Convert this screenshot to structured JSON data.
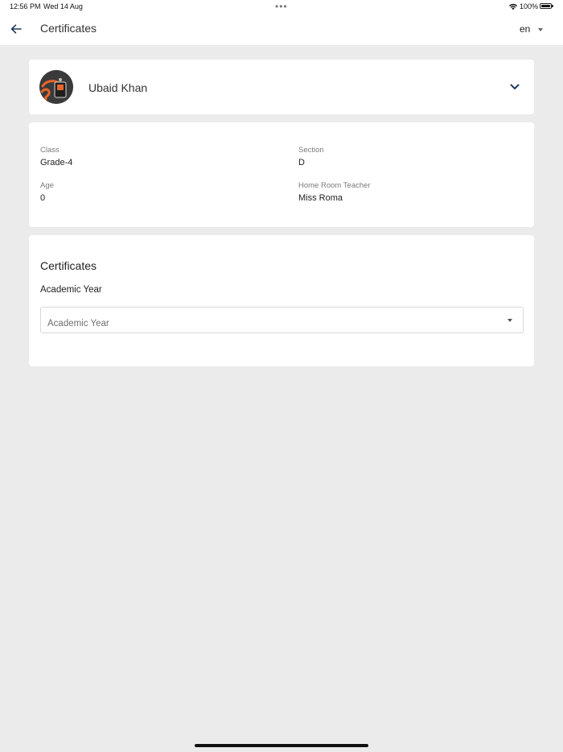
{
  "status_bar": {
    "time": "12:56 PM",
    "date": "Wed 14 Aug",
    "more": "•••",
    "battery_percent": "100%"
  },
  "header": {
    "title": "Certificates",
    "language": "en"
  },
  "profile": {
    "name": "Ubaid Khan"
  },
  "student_info": {
    "class_label": "Class",
    "class_value": "Grade-4",
    "section_label": "Section",
    "section_value": "D",
    "age_label": "Age",
    "age_value": "0",
    "teacher_label": "Home Room Teacher",
    "teacher_value": "Miss Roma"
  },
  "certificates": {
    "heading": "Certificates",
    "academic_year_label": "Academic Year",
    "academic_year_placeholder": "Academic Year"
  },
  "icons": {
    "back": "arrow-left-icon",
    "language_dropdown": "caret-down-icon",
    "expand": "chevron-down-icon",
    "select_caret": "caret-down-icon",
    "wifi": "wifi-icon",
    "battery": "battery-icon"
  },
  "colors": {
    "background": "#ebebeb",
    "card": "#ffffff",
    "text_primary": "#222222",
    "text_secondary": "#7a7a7a",
    "accent_chevron": "#1f3b5c"
  }
}
